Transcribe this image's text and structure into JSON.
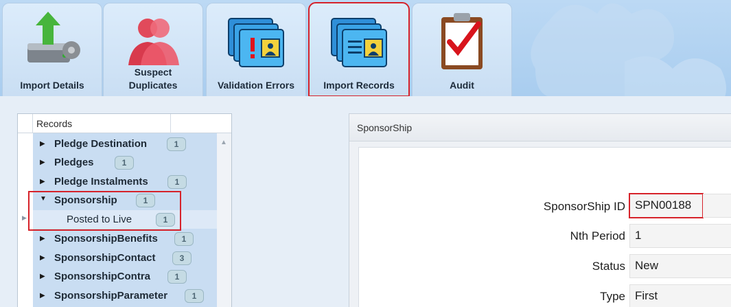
{
  "ribbon": {
    "tabs": [
      {
        "label": "Import Details"
      },
      {
        "label": "Suspect\nDuplicates"
      },
      {
        "label": "Validation Errors"
      },
      {
        "label": "Import Records",
        "active": true
      },
      {
        "label": "Audit"
      }
    ]
  },
  "tree": {
    "header": "Records",
    "rows": [
      {
        "name": "Pledge Destination",
        "count": "1"
      },
      {
        "name": "Pledges",
        "count": "1"
      },
      {
        "name": "Pledge Instalments",
        "count": "1"
      },
      {
        "name": "Sponsorship",
        "count": "1",
        "expanded": true
      },
      {
        "name": "Posted to Live",
        "count": "1",
        "child": true
      },
      {
        "name": "SponsorshipBenefits",
        "count": "1"
      },
      {
        "name": "SponsorshipContact",
        "count": "3"
      },
      {
        "name": "SponsorshipContra",
        "count": "1"
      },
      {
        "name": "SponsorshipParameter",
        "count": "1"
      }
    ]
  },
  "detail": {
    "title": "SponsorShip",
    "fields": [
      {
        "label": "SponsorShip ID",
        "value": "SPN00188"
      },
      {
        "label": "Nth Period",
        "value": "1"
      },
      {
        "label": "Status",
        "value": "New"
      },
      {
        "label": "Type",
        "value": "First"
      }
    ]
  },
  "colors": {
    "highlight": "#d6222a",
    "ribbon_bg": "#a9cdef",
    "tree_selection": "#c9ddf2",
    "badge_bg": "#c5dbe4"
  }
}
